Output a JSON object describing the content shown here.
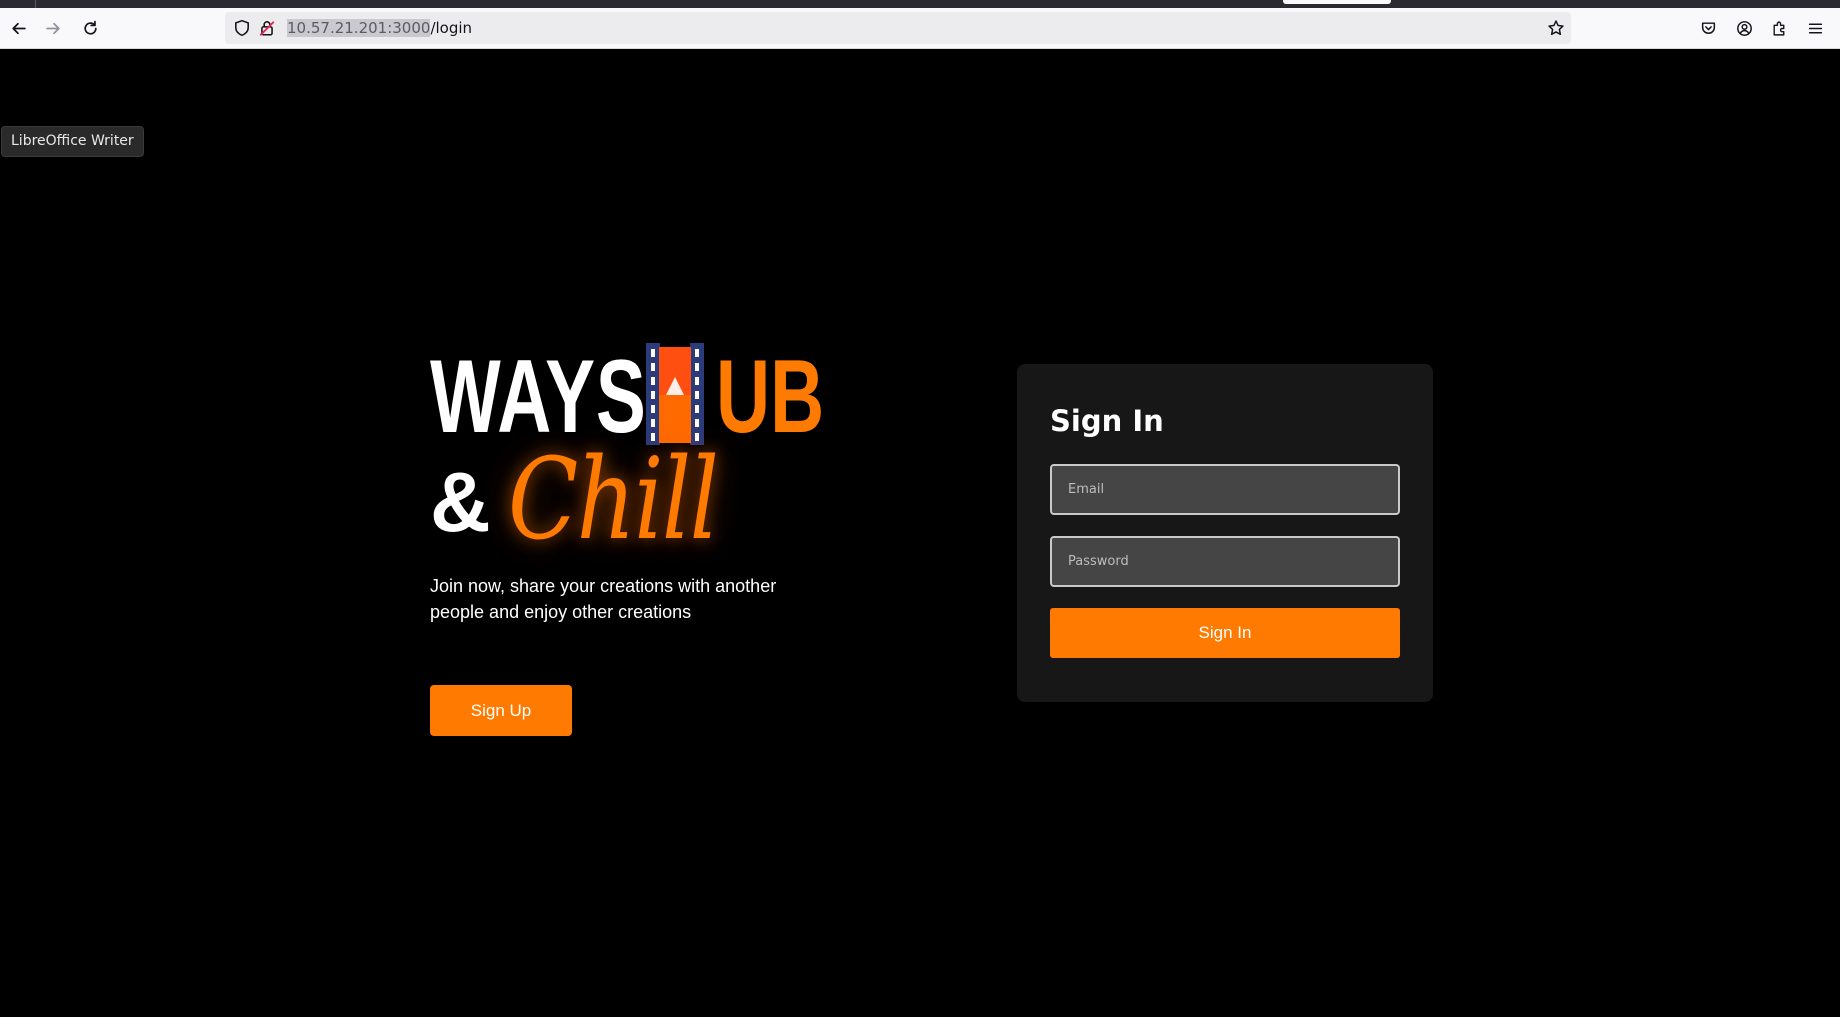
{
  "browser": {
    "url_host": "10.57.21.201:3000",
    "url_path": "/login",
    "icons": [
      "back-arrow-icon",
      "forward-arrow-icon",
      "reload-icon",
      "shield-icon",
      "lock-icon",
      "star-icon",
      "pocket-icon",
      "account-icon",
      "extensions-icon",
      "menu-icon"
    ]
  },
  "tooltip": {
    "text": "LibreOffice Writer"
  },
  "hero": {
    "logo_ways": "WAYS",
    "logo_ub": "UB",
    "logo_amp": "&",
    "logo_chill": "Chill",
    "tagline": "Join now, share your creations with another people and enjoy other creations",
    "signup_label": "Sign Up"
  },
  "signin": {
    "title": "Sign In",
    "email_placeholder": "Email",
    "password_placeholder": "Password",
    "button_label": "Sign In"
  },
  "colors": {
    "accent": "#ff7a00",
    "background": "#000000",
    "card": "#171717"
  }
}
